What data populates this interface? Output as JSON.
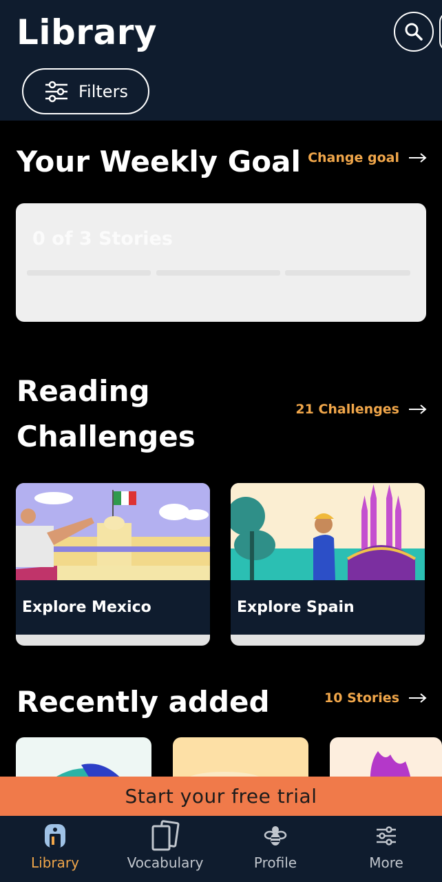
{
  "header": {
    "title": "Library",
    "filters_label": "Filters"
  },
  "weekly_goal": {
    "title": "Your Weekly Goal",
    "link_label": "Change goal",
    "progress_text": "0 of 3 Stories",
    "stories_completed": 0,
    "stories_target": 3
  },
  "challenges": {
    "title_line1": "Reading",
    "title_line2": "Challenges",
    "link_label": "21 Challenges",
    "items": [
      {
        "name": "Explore Mexico"
      },
      {
        "name": "Explore Spain"
      }
    ]
  },
  "recent": {
    "title": "Recently added",
    "link_label": "10 Stories"
  },
  "trial": {
    "label": "Start your free trial"
  },
  "tabs": [
    {
      "label": "Library",
      "icon": "library-icon",
      "active": true
    },
    {
      "label": "Vocabulary",
      "icon": "vocabulary-cards-icon",
      "active": false
    },
    {
      "label": "Profile",
      "icon": "profile-bee-icon",
      "active": false
    },
    {
      "label": "More",
      "icon": "more-sliders-icon",
      "active": false
    }
  ],
  "colors": {
    "header_bg": "#0f1c2e",
    "accent": "#f0a64a",
    "trial_bg": "#f07a4a",
    "page_bg": "#000000"
  }
}
